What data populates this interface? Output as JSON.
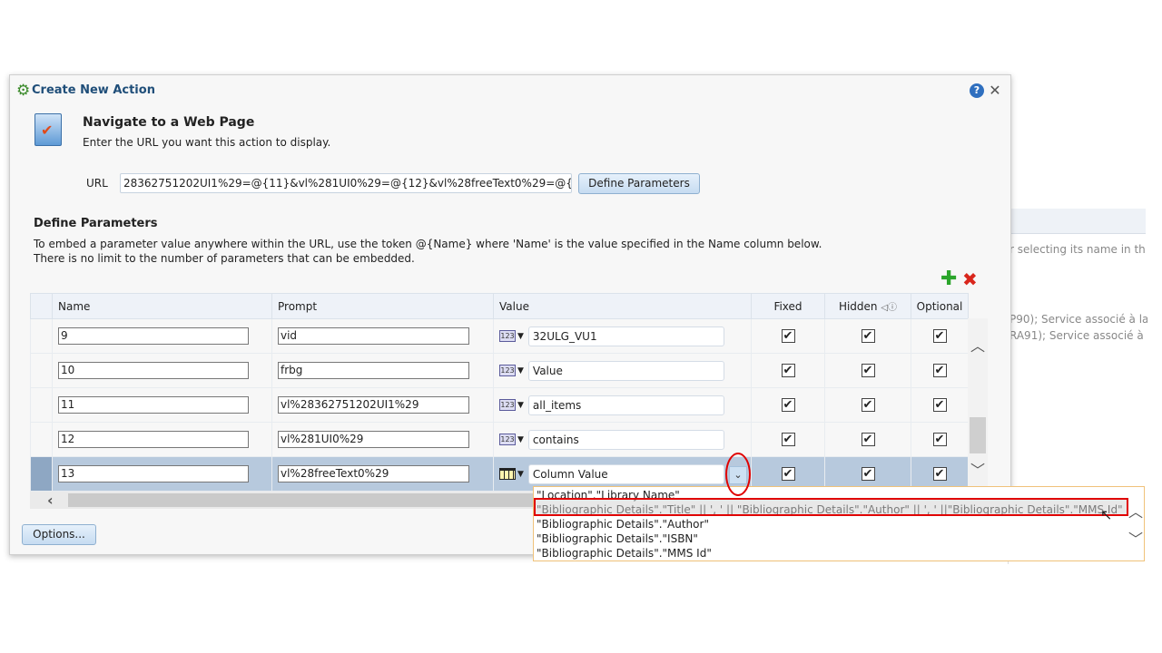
{
  "background": {
    "lines": [
      "r selecting its name in th",
      "P90); Service associé à la",
      "RA91); Service associé à"
    ]
  },
  "dialog": {
    "title": "Create New Action",
    "heading": "Navigate to a Web Page",
    "subheading": "Enter the URL you want this action to display.",
    "url_label": "URL",
    "url_value": "28362751202UI1%29=@{11}&vl%281UI0%29=@{12}&vl%28freeText0%29=@{",
    "define_parameters_button": "Define Parameters",
    "params_heading": "Define Parameters",
    "params_desc_1": "To embed a parameter value anywhere within the URL, use the token @{Name} where 'Name' is the value specified in the Name column below.",
    "params_desc_2": "There is no limit to the number of parameters that can be embedded.",
    "options_button": "Options..."
  },
  "table": {
    "headers": {
      "name": "Name",
      "prompt": "Prompt",
      "value": "Value",
      "fixed": "Fixed",
      "hidden": "Hidden",
      "optional": "Optional"
    },
    "rows": [
      {
        "name": "9",
        "prompt": "vid",
        "value_type": "123",
        "value": "32ULG_VU1",
        "fixed": true,
        "hidden": true,
        "optional": true
      },
      {
        "name": "10",
        "prompt": "frbg",
        "value_type": "123",
        "value": "Value",
        "fixed": true,
        "hidden": true,
        "optional": true
      },
      {
        "name": "11",
        "prompt": "vl%28362751202UI1%29",
        "value_type": "123",
        "value": "all_items",
        "fixed": true,
        "hidden": true,
        "optional": true
      },
      {
        "name": "12",
        "prompt": "vl%281UI0%29",
        "value_type": "123",
        "value": "contains",
        "fixed": true,
        "hidden": true,
        "optional": true
      },
      {
        "name": "13",
        "prompt": "vl%28freeText0%29",
        "value_type": "column",
        "value": "Column Value",
        "fixed": true,
        "hidden": true,
        "optional": true,
        "selected": true
      }
    ]
  },
  "dropdown": {
    "options": [
      "\"Location\".\"Library Name\"",
      "\"Bibliographic Details\".\"Title\" || ', ' || \"Bibliographic Details\".\"Author\" || ', ' ||\"Bibliographic Details\".\"MMS Id\"",
      "\"Bibliographic Details\".\"Author\"",
      "\"Bibliographic Details\".\"ISBN\"",
      "\"Bibliographic Details\".\"MMS Id\""
    ],
    "highlighted_index": 1
  },
  "colors": {
    "title": "#1f4e79",
    "selected_row": "#b7c9dd",
    "annotation": "#e00000",
    "add": "#2ba52b",
    "delete": "#d9261c"
  }
}
